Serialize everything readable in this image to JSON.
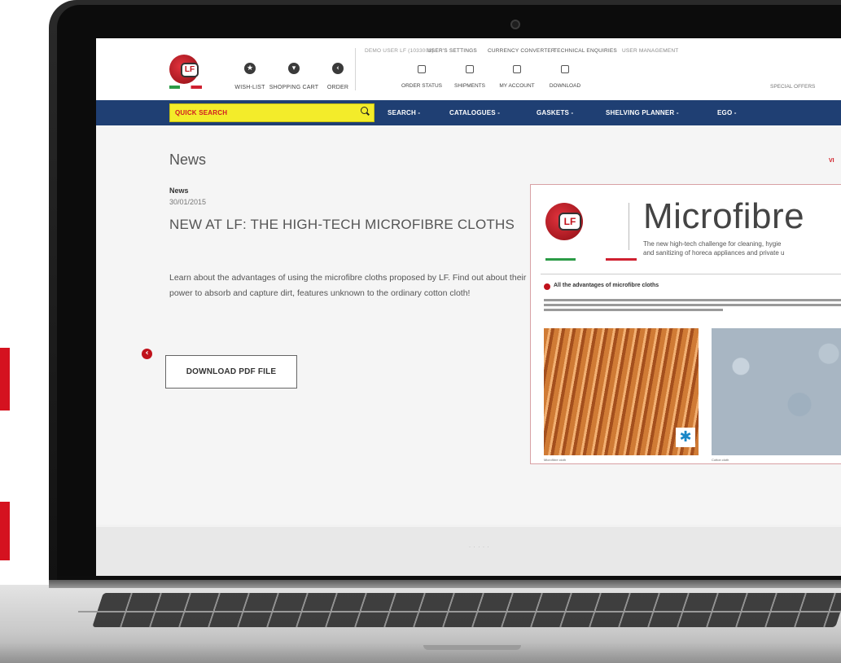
{
  "colors": {
    "brand_red": "#d5121f",
    "nav_blue": "#1f3f73",
    "quick_search_yellow": "#f3ec2a"
  },
  "header": {
    "logo_text": "LF",
    "quick_links": [
      {
        "label": "WISH-LIST",
        "icon": "star-icon"
      },
      {
        "label": "SHOPPING CART",
        "icon": "cart-icon"
      },
      {
        "label": "ORDER",
        "icon": "arrow-icon"
      }
    ],
    "top_links": {
      "user": "DEMO USER LF (1033006)",
      "settings": "USER'S SETTINGS",
      "currency": "CURRENCY CONVERTER",
      "technical": "TECHNICAL ENQUIRIES",
      "management": "USER MANAGEMENT"
    },
    "account_links": [
      {
        "label": "ORDER STATUS",
        "icon": "clipboard-icon"
      },
      {
        "label": "SHIPMENTS",
        "icon": "truck-icon"
      },
      {
        "label": "MY ACCOUNT",
        "icon": "calendar-icon"
      },
      {
        "label": "DOWNLOAD",
        "icon": "download-icon"
      }
    ],
    "special_offers": "SPECIAL OFFERS"
  },
  "nav": {
    "quick_search_placeholder": "QUICK SEARCH",
    "items": [
      "SEARCH -",
      "CATALOGUES -",
      "GASKETS -",
      "SHELVING PLANNER -",
      "EGO -"
    ]
  },
  "news": {
    "heading": "News",
    "view_all": "VI",
    "label": "News",
    "date": "30/01/2015",
    "title": "NEW AT LF: THE HIGH-TECH MICROFIBRE CLOTHS",
    "body": "Learn about the advantages of using the microfibre cloths proposed by LF. Find out about their power to absorb and capture dirt, features unknown to the ordinary cotton cloth!",
    "download_label": "DOWNLOAD PDF FILE"
  },
  "card": {
    "logo_text": "LF",
    "title": "Microfibre",
    "subtitle_1": "The new high-tech challenge for cleaning, hygie",
    "subtitle_2": "and sanitizing of horeca appliances and private u",
    "advantages_heading": "All the advantages of microfibre cloths",
    "micro_caption": "Microfibre cloth",
    "cotton_caption": "Cotton cloth"
  },
  "pager": {
    "active_index": 4,
    "count": 5
  },
  "footer": {
    "text": "· · · · ·"
  }
}
